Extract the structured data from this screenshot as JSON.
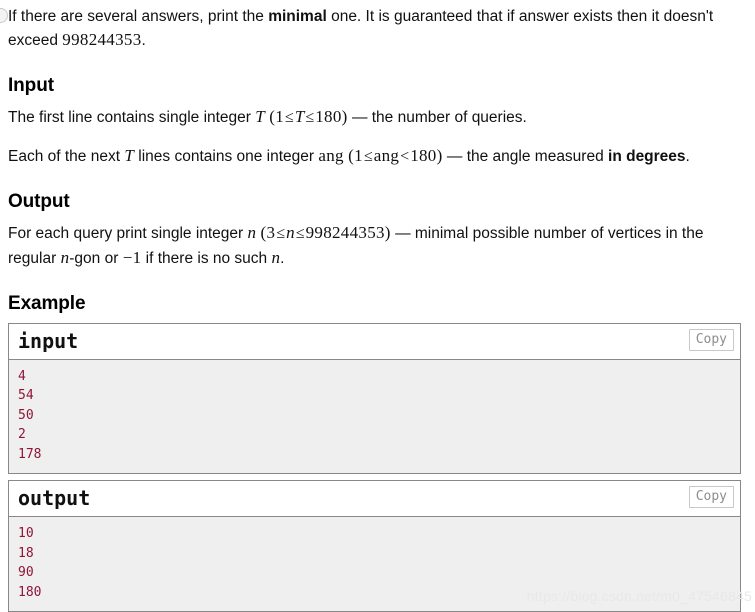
{
  "statement": {
    "note_line_1_a": "If there are several answers, print the ",
    "note_bold": "minimal",
    "note_line_1_b": " one. It is guaranteed that if answer exists then it doesn't exceed ",
    "note_number": "998244353",
    "note_line_1_c": "."
  },
  "input_section": {
    "heading": "Input",
    "line1_a": "The first line contains single integer ",
    "line1_var": "T",
    "line1_paren_open": "(",
    "line1_lower": "1",
    "line1_le1": "≤",
    "line1_var2": "T",
    "line1_le2": "≤",
    "line1_upper": "180",
    "line1_paren_close": ")",
    "line1_dash": "—",
    "line1_b": " the number of queries.",
    "line2_a": "Each of the next ",
    "line2_var": "T",
    "line2_b": " lines contains one integer ",
    "line2_ang": "ang",
    "line2_paren_open": "(",
    "line2_lower": "1",
    "line2_le": "≤",
    "line2_ang2": "ang",
    "line2_lt": "<",
    "line2_upper": "180",
    "line2_paren_close": ")",
    "line2_dash": "—",
    "line2_c": " the angle measured ",
    "line2_bold": "in degrees",
    "line2_d": "."
  },
  "output_section": {
    "heading": "Output",
    "line1_a": "For each query print single integer ",
    "line1_var": "n",
    "line1_paren_open": "(",
    "line1_lower": "3",
    "line1_le1": "≤",
    "line1_var2": "n",
    "line1_le2": "≤",
    "line1_upper": "998244353",
    "line1_paren_close": ")",
    "line1_dash": "—",
    "line1_b": " minimal possible number of vertices in the regular ",
    "line1_var3": "n",
    "line1_c": "-gon or ",
    "line1_minus_one": "−1",
    "line1_d": " if there is no such ",
    "line1_var4": "n",
    "line1_e": "."
  },
  "example_section": {
    "heading": "Example",
    "samples": [
      {
        "title": "input",
        "copy_label": "Copy",
        "content": "4\n54\n50\n2\n178"
      },
      {
        "title": "output",
        "copy_label": "Copy",
        "content": "10\n18\n90\n180"
      }
    ]
  },
  "watermark": {
    "text": "https://blog.csdn.net/m0_47546845"
  },
  "colors": {
    "code_text": "#8f1638",
    "code_background": "#efefef",
    "box_border": "#888888",
    "body_text": "#111111"
  }
}
